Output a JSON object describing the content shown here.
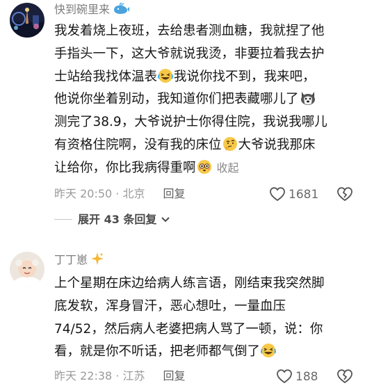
{
  "comments": [
    {
      "username": "快到碗里来",
      "user_icon": "whale-icon",
      "lines": [
        "我发着烧上夜班，去给患者测血糖，我就捏了他",
        "手指头一下，这大爷就说我烫，非要拉着我去护",
        "士站给我找体温表",
        "我说你找不到，我来吧，",
        "他说你坐着别动，我知道你们把表藏哪儿了",
        "测完了38.9，大爷说护士你得住院，我说我哪儿",
        "有资格住院啊，没有我的床位",
        "大爷说我那床",
        "让给你，你比我病得重啊"
      ],
      "collapse_label": "收起",
      "time": "昨天 20:50",
      "location": "北京",
      "reply_label": "回复",
      "likes": "1681",
      "expand_label": "展开 43 条回复"
    },
    {
      "username": "丁丁崽",
      "user_icon": "sparkle-icon",
      "lines": [
        "上个星期在床边给病人练言语，刚结束我突然脚",
        "底发软，浑身冒汗，恶心想吐，一量血压",
        "74/52，然后病人老婆把病人骂了一顿，说：你",
        "看，就是你不听话，把老师都气倒了"
      ],
      "time": "昨天 22:38",
      "location": "江苏",
      "reply_label": "回复",
      "likes": "188"
    }
  ],
  "colors": {
    "text": "#161616",
    "meta": "#9a9a9a",
    "username": "#7d7d7d",
    "emoji": "#f7c948"
  }
}
